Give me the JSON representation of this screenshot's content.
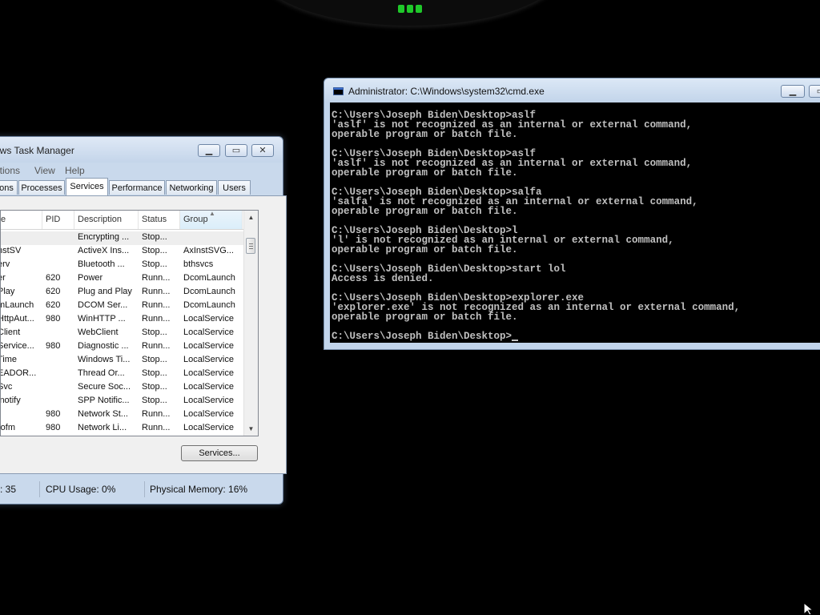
{
  "taskmgr": {
    "title": "ows Task Manager",
    "menu": [
      "ptions",
      "View",
      "Help"
    ],
    "tabs": [
      "ons",
      "Processes",
      "Services",
      "Performance",
      "Networking",
      "Users"
    ],
    "active_tab": "Services",
    "columns": [
      "e",
      "PID",
      "Description",
      "Status",
      "Group"
    ],
    "rows": [
      {
        "name": "",
        "pid": "",
        "desc": "Encrypting ...",
        "status": "Stop...",
        "group": ""
      },
      {
        "name": "nstSV",
        "pid": "",
        "desc": "ActiveX Ins...",
        "status": "Stop...",
        "group": "AxInstSVG..."
      },
      {
        "name": "erv",
        "pid": "",
        "desc": "Bluetooth ...",
        "status": "Stop...",
        "group": "bthsvcs"
      },
      {
        "name": "er",
        "pid": "620",
        "desc": "Power",
        "status": "Runn...",
        "group": "DcomLaunch"
      },
      {
        "name": "Play",
        "pid": "620",
        "desc": "Plug and Play",
        "status": "Runn...",
        "group": "DcomLaunch"
      },
      {
        "name": "mLaunch",
        "pid": "620",
        "desc": "DCOM Ser...",
        "status": "Runn...",
        "group": "DcomLaunch"
      },
      {
        "name": "HttpAut...",
        "pid": "980",
        "desc": "WinHTTP ...",
        "status": "Runn...",
        "group": "LocalService"
      },
      {
        "name": "Client",
        "pid": "",
        "desc": "WebClient",
        "status": "Stop...",
        "group": "LocalService"
      },
      {
        "name": "Service...",
        "pid": "980",
        "desc": "Diagnostic ...",
        "status": "Runn...",
        "group": "LocalService"
      },
      {
        "name": "Time",
        "pid": "",
        "desc": "Windows Ti...",
        "status": "Stop...",
        "group": "LocalService"
      },
      {
        "name": "EADOR...",
        "pid": "",
        "desc": "Thread Or...",
        "status": "Stop...",
        "group": "LocalService"
      },
      {
        "name": "Svc",
        "pid": "",
        "desc": "Secure Soc...",
        "status": "Stop...",
        "group": "LocalService"
      },
      {
        "name": "inotify",
        "pid": "",
        "desc": "SPP Notific...",
        "status": "Stop...",
        "group": "LocalService"
      },
      {
        "name": "",
        "pid": "980",
        "desc": "Network St...",
        "status": "Runn...",
        "group": "LocalService"
      },
      {
        "name": "rofm",
        "pid": "980",
        "desc": "Network Li...",
        "status": "Runn...",
        "group": "LocalService"
      }
    ],
    "services_button": "Services...",
    "status": {
      "processes": ": 35",
      "cpu": "CPU Usage: 0%",
      "memory": "Physical Memory: 16%"
    }
  },
  "cmd": {
    "title": "Administrator: C:\\Windows\\system32\\cmd.exe",
    "lines": [
      "C:\\Users\\Joseph Biden\\Desktop>aslf",
      "'aslf' is not recognized as an internal or external command,",
      "operable program or batch file.",
      "",
      "C:\\Users\\Joseph Biden\\Desktop>aslf",
      "'aslf' is not recognized as an internal or external command,",
      "operable program or batch file.",
      "",
      "C:\\Users\\Joseph Biden\\Desktop>salfa",
      "'salfa' is not recognized as an internal or external command,",
      "operable program or batch file.",
      "",
      "C:\\Users\\Joseph Biden\\Desktop>l",
      "'l' is not recognized as an internal or external command,",
      "operable program or batch file.",
      "",
      "C:\\Users\\Joseph Biden\\Desktop>start lol",
      "Access is denied.",
      "",
      "C:\\Users\\Joseph Biden\\Desktop>explorer.exe",
      "'explorer.exe' is not recognized as an internal or external command,",
      "operable program or batch file.",
      ""
    ],
    "prompt": "C:\\Users\\Joseph Biden\\Desktop>"
  }
}
